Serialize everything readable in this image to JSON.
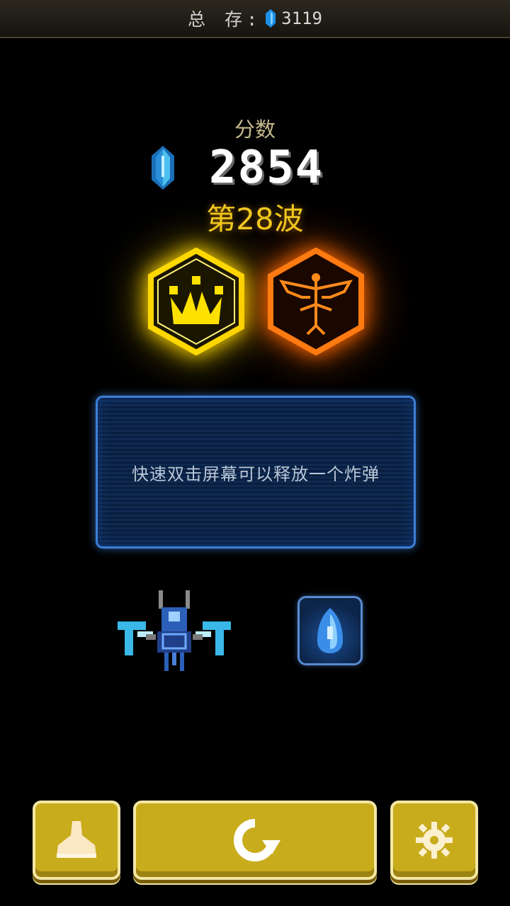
{
  "header": {
    "total_label": "总 存:",
    "total_value": "3119",
    "gem_icon": "blue-crystal-icon"
  },
  "results": {
    "score_label": "分数",
    "score": "2854",
    "wave_label": "第28波"
  },
  "medals": [
    {
      "icon": "crown-medal-icon",
      "color": "#ffd800"
    },
    {
      "icon": "eagle-medal-icon",
      "color": "#ff7a10"
    }
  ],
  "tip": {
    "text": "快速双击屏幕可以释放一个炸弹"
  },
  "loadout": {
    "ship_icon": "blue-spaceship-icon",
    "bomb_icon": "blue-bomb-icon"
  },
  "buttons": [
    {
      "name": "hangar",
      "icon": "ship-silhouette-icon"
    },
    {
      "name": "restart",
      "icon": "restart-arrow-icon"
    },
    {
      "name": "settings",
      "icon": "gear-icon"
    }
  ],
  "colors": {
    "accent_gold": "#c9ac1c",
    "wave_gold": "#f0c820",
    "panel_blue": "#3d7fd6"
  }
}
